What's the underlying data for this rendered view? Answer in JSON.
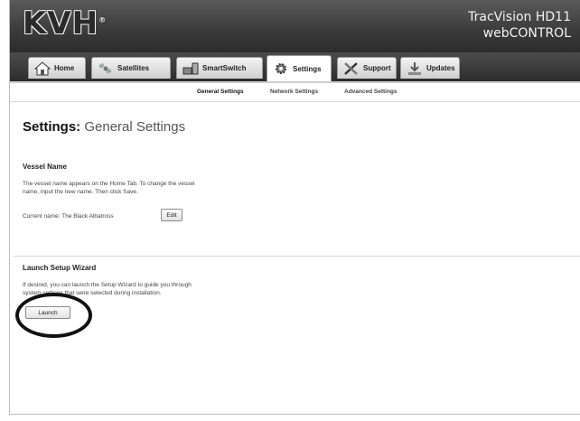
{
  "header": {
    "logo": "KVH",
    "product_line1": "TracVision HD11",
    "product_line2": "webCONTROL"
  },
  "tabs": [
    {
      "label": "Home",
      "icon": "home-icon"
    },
    {
      "label": "Satellites",
      "icon": "satellite-icon"
    },
    {
      "label": "SmartSwitch",
      "icon": "smartswitch-icon"
    },
    {
      "label": "Settings",
      "icon": "gear-icon",
      "active": true
    },
    {
      "label": "Support",
      "icon": "tools-icon"
    },
    {
      "label": "Updates",
      "icon": "download-icon"
    }
  ],
  "subnav": {
    "general": "General Settings",
    "network": "Network Settings",
    "advanced": "Advanced Settings"
  },
  "page": {
    "title_bold": "Settings:",
    "title_rest": "General Settings"
  },
  "vessel": {
    "heading": "Vessel Name",
    "desc_line1": "The vessel name appears on the Home Tab. To change the vessel",
    "desc_line2": "name, input the new name. Then click Save.",
    "current_label": "Current name: The Black Albatross",
    "edit_label": "Edit"
  },
  "wizard": {
    "heading": "Launch Setup Wizard",
    "desc_line1": "If desired, you can launch the Setup Wizard to guide you through",
    "desc_line2": "system settings that were selected during installation.",
    "launch_label": "Launch"
  }
}
